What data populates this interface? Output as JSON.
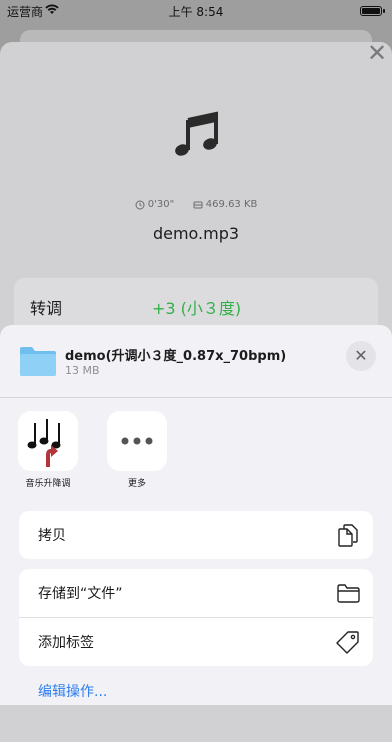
{
  "status_bar": {
    "carrier": "运营商",
    "time": "上午 8:54"
  },
  "background": {
    "duration": "0'30\"",
    "file_size": "469.63 KB",
    "file_name": "demo.mp3",
    "transpose_label": "转调",
    "transpose_value": "+3 (小３度)"
  },
  "sheet": {
    "title": "demo(升调小３度_0.87x_70bpm)",
    "subtitle": "13 MB",
    "apps": [
      {
        "label": "音乐升降调"
      },
      {
        "label": "更多"
      }
    ],
    "actions_group1": [
      {
        "label": "拷贝",
        "icon": "copy-icon"
      }
    ],
    "actions_group2": [
      {
        "label": "存储到“文件”",
        "icon": "folder-icon"
      },
      {
        "label": "添加标签",
        "icon": "tag-icon"
      }
    ],
    "edit_actions": "编辑操作..."
  },
  "colors": {
    "accent_green": "#33b04a",
    "link_blue": "#2f7ef0",
    "arrow_red": "#b3353c"
  }
}
